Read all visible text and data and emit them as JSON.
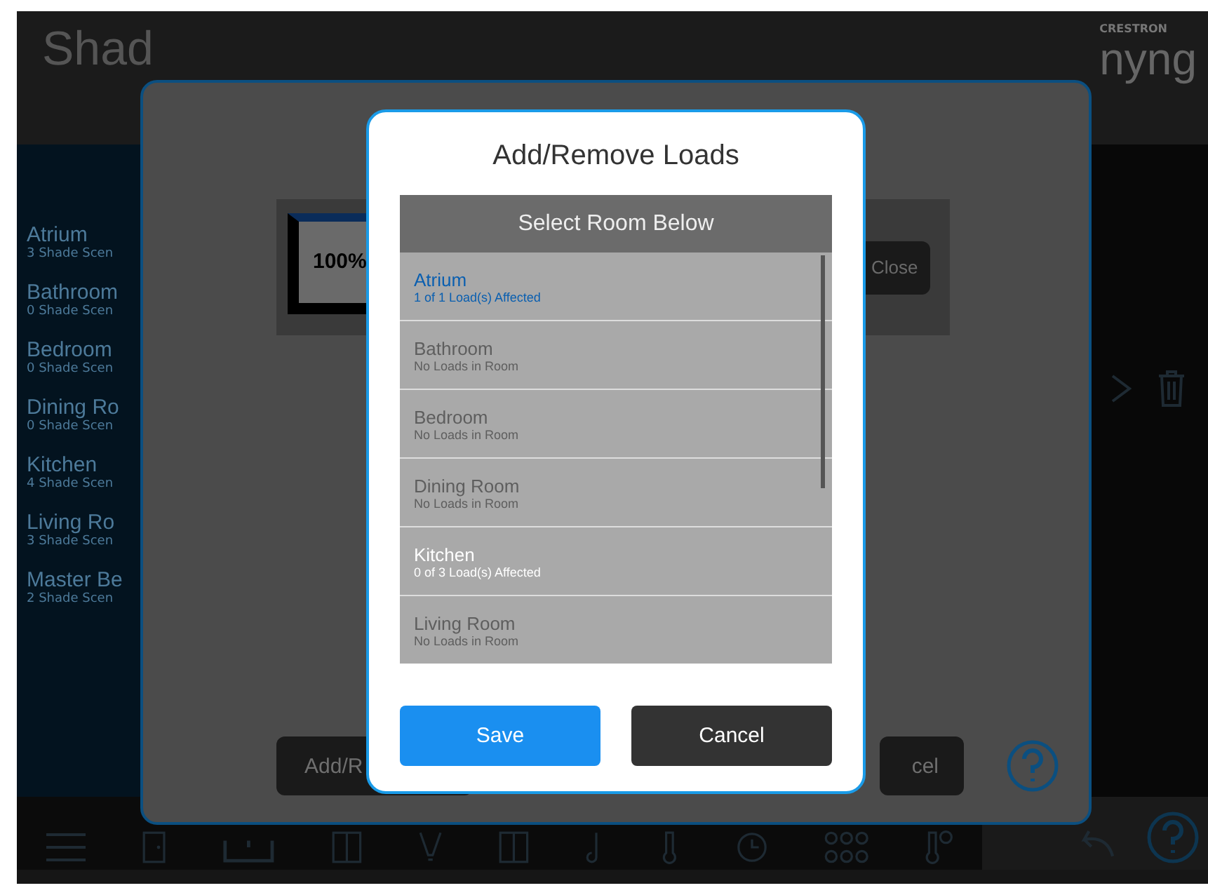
{
  "header": {
    "title": "Shad",
    "logo_small": "CRESTRON",
    "logo": "nyng"
  },
  "sidebar": {
    "items": [
      {
        "name": "Atrium",
        "subtitle": "3 Shade Scen"
      },
      {
        "name": "Bathroom",
        "subtitle": "0 Shade Scen"
      },
      {
        "name": "Bedroom",
        "subtitle": "0 Shade Scen"
      },
      {
        "name": "Dining Ro",
        "subtitle": "0 Shade Scen"
      },
      {
        "name": "Kitchen",
        "subtitle": "4 Shade Scen"
      },
      {
        "name": "Living Ro",
        "subtitle": "3 Shade Scen"
      },
      {
        "name": "Master Be",
        "subtitle": "2 Shade Scen"
      }
    ]
  },
  "scene_panel": {
    "preview_value": "100%",
    "close_button": "Close",
    "left_button": "Add/R",
    "right_button": "cel"
  },
  "dialog": {
    "title": "Add/Remove Loads",
    "list_header": "Select Room Below",
    "rooms": [
      {
        "name": "Atrium",
        "status": "1 of 1 Load(s) Affected",
        "selected": true,
        "disabled": false
      },
      {
        "name": "Bathroom",
        "status": "No Loads in Room",
        "selected": false,
        "disabled": true
      },
      {
        "name": "Bedroom",
        "status": "No Loads in Room",
        "selected": false,
        "disabled": true
      },
      {
        "name": "Dining Room",
        "status": "No Loads in Room",
        "selected": false,
        "disabled": true
      },
      {
        "name": "Kitchen",
        "status": "0 of 3 Load(s) Affected",
        "selected": false,
        "disabled": false
      },
      {
        "name": "Living Room",
        "status": "No Loads in Room",
        "selected": false,
        "disabled": true
      }
    ],
    "buttons": [
      {
        "label": "Save",
        "kind": "primary"
      },
      {
        "label": "Cancel",
        "kind": "secondary"
      }
    ]
  }
}
